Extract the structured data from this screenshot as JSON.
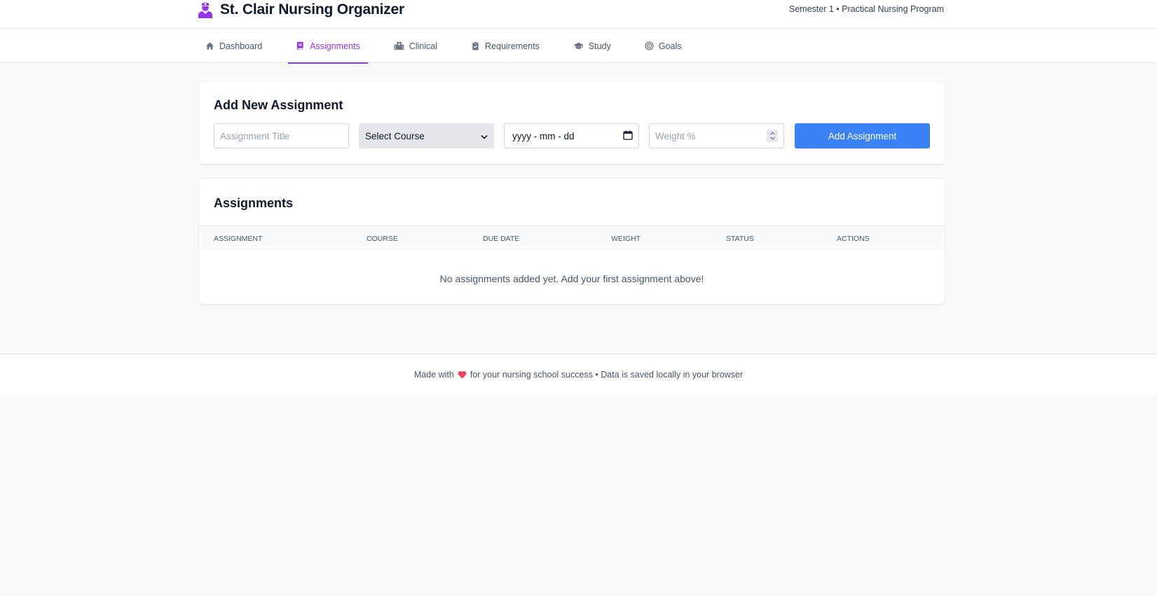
{
  "app": {
    "title": "St. Clair Nursing Organizer",
    "subtitle": "Semester 1 • Practical Nursing Program",
    "logo_icon": "nurse-icon"
  },
  "nav": {
    "tabs": [
      {
        "label": "Dashboard",
        "icon": "home-icon",
        "active": false
      },
      {
        "label": "Assignments",
        "icon": "book-icon",
        "active": true
      },
      {
        "label": "Clinical",
        "icon": "hospital-icon",
        "active": false
      },
      {
        "label": "Requirements",
        "icon": "clipboard-check-icon",
        "active": false
      },
      {
        "label": "Study",
        "icon": "graduation-cap-icon",
        "active": false
      },
      {
        "label": "Goals",
        "icon": "target-icon",
        "active": false
      }
    ]
  },
  "add_form": {
    "heading": "Add New Assignment",
    "title_placeholder": "Assignment Title",
    "course_selected": "Select Course",
    "date_placeholder": "yyyy - mm - dd",
    "weight_placeholder": "Weight %",
    "submit_label": "Add Assignment"
  },
  "list": {
    "heading": "Assignments",
    "columns": [
      "Assignment",
      "Course",
      "Due Date",
      "Weight",
      "Status",
      "Actions"
    ],
    "empty_message": "No assignments added yet. Add your first assignment above!"
  },
  "footer": {
    "prefix": "Made with",
    "suffix": "for your nursing school success • Data is saved locally in your browser"
  },
  "colors": {
    "accent": "#9333ea",
    "primary_button": "#3b82f6",
    "heart": "#f43f5e"
  }
}
